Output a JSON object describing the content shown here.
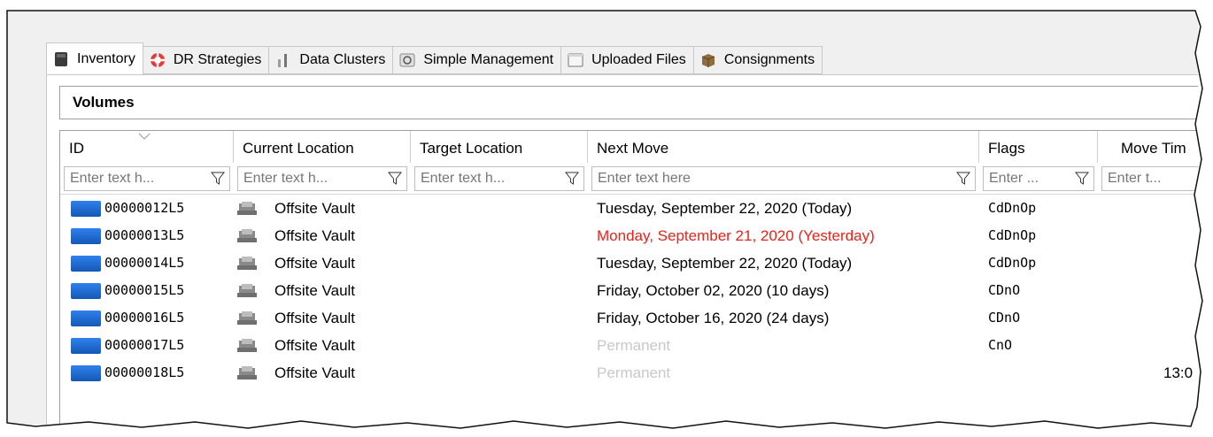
{
  "tabs": [
    {
      "label": "Inventory",
      "icon": "inventory-icon",
      "active": true
    },
    {
      "label": "DR Strategies",
      "icon": "lifebuoy-icon",
      "active": false
    },
    {
      "label": "Data Clusters",
      "icon": "clusters-icon",
      "active": false
    },
    {
      "label": "Simple Management",
      "icon": "simple-management-icon",
      "active": false
    },
    {
      "label": "Uploaded Files",
      "icon": "uploaded-files-icon",
      "active": false
    },
    {
      "label": "Consignments",
      "icon": "consignments-icon",
      "active": false
    }
  ],
  "section": {
    "title": "Volumes"
  },
  "grid": {
    "columns": [
      "ID",
      "Current Location",
      "Target Location",
      "Next Move",
      "Flags",
      "Move Tim"
    ],
    "filters": [
      "Enter text h...",
      "Enter text h...",
      "Enter text h...",
      "Enter text here",
      "Enter ...",
      "Enter t..."
    ],
    "rows": [
      {
        "id": "00000012L5",
        "current": "Offsite Vault",
        "target": "",
        "next": "Tuesday, September 22, 2020 (Today)",
        "flags": "CdDnOp",
        "move_time": ""
      },
      {
        "id": "00000013L5",
        "current": "Offsite Vault",
        "target": "",
        "next": "Monday, September 21, 2020 (Yesterday)",
        "flags": "CdDnOp",
        "move_time": ""
      },
      {
        "id": "00000014L5",
        "current": "Offsite Vault",
        "target": "",
        "next": "Tuesday, September 22, 2020 (Today)",
        "flags": "CdDnOp",
        "move_time": ""
      },
      {
        "id": "00000015L5",
        "current": "Offsite Vault",
        "target": "",
        "next": "Friday, October 02, 2020 (10 days)",
        "flags": "CDnO",
        "move_time": ""
      },
      {
        "id": "00000016L5",
        "current": "Offsite Vault",
        "target": "",
        "next": "Friday, October 16, 2020 (24 days)",
        "flags": "CDnO",
        "move_time": ""
      },
      {
        "id": "00000017L5",
        "current": "Offsite Vault",
        "target": "",
        "next": "Permanent",
        "flags": "CnO",
        "move_time": ""
      },
      {
        "id": "00000018L5",
        "current": "Offsite Vault",
        "target": "",
        "next": "Permanent",
        "flags": "",
        "move_time": "13:0"
      }
    ]
  },
  "colors": {
    "overdue": "#e8231c",
    "muted": "#c8c8c8",
    "tape": "#2f80ed"
  }
}
